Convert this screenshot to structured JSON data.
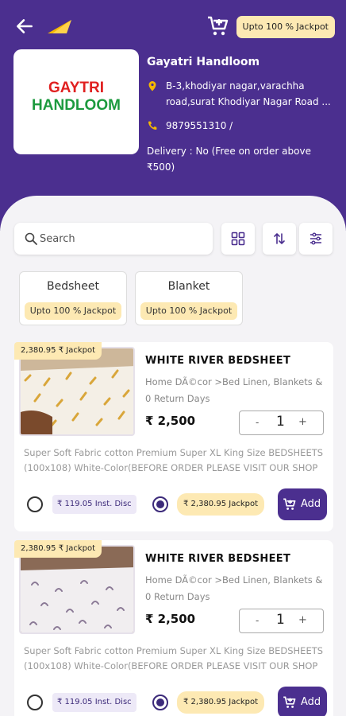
{
  "header": {
    "jackpot_pill": "Upto 100 % Jackpot",
    "store": {
      "logo_line1": "GAYTRI",
      "logo_line2": "HANDLOOM",
      "name": "Gayatri Handloom",
      "address": "B-3,khodiyar nagar,varachha road,surat Khodiyar Nagar Road ...",
      "phone": "9879551310 /",
      "delivery": "Delivery : No (Free on order above ₹500)"
    }
  },
  "search": {
    "placeholder": "Search"
  },
  "categories": [
    {
      "name": "Bedsheet",
      "badge": "Upto 100 % Jackpot"
    },
    {
      "name": "Blanket",
      "badge": "Upto 100 % Jackpot"
    }
  ],
  "products": [
    {
      "badge": "2,380.95 ₹ Jackpot",
      "title": "WHITE RIVER BEDSHEET",
      "category": "Home DÃ©cor >Bed Linen, Blankets & 0 Return Days",
      "price": "₹ 2,500",
      "qty_minus": "-",
      "qty": "1",
      "qty_plus": "+",
      "description": "Super Soft Fabric cotton Premium Super XL King Size  BEDSHEETS (100x108) White-Color(BEFORE ORDER PLEASE VISIT OUR SHOP FOR...",
      "inst_disc": "₹ 119.05 Inst. Disc",
      "jackpot": "₹ 2,380.95 Jackpot",
      "add_label": "Add"
    },
    {
      "badge": "2,380.95 ₹ Jackpot",
      "title": "WHITE RIVER BEDSHEET",
      "category": "Home DÃ©cor >Bed Linen, Blankets & 0 Return Days",
      "price": "₹ 2,500",
      "qty_minus": "-",
      "qty": "1",
      "qty_plus": "+",
      "description": "Super Soft Fabric cotton Premium Super XL King Size  BEDSHEETS (100x108) White-Color(BEFORE ORDER PLEASE VISIT OUR SHOP FOR...",
      "inst_disc": "₹ 119.05 Inst. Disc",
      "jackpot": "₹ 2,380.95 Jackpot",
      "add_label": "Add"
    }
  ],
  "icons": {
    "back": "back-arrow-icon",
    "brand": "brand-logo-icon",
    "cart": "cart-add-icon",
    "location": "location-pin-icon",
    "phone": "phone-icon",
    "search": "search-icon",
    "grid": "grid-view-icon",
    "sort": "sort-icon",
    "filter": "filter-icon"
  },
  "colors": {
    "primary": "#4b2f8f",
    "jackpot_bg": "#fde9b3",
    "accent_icon": "#f5b800",
    "logo_red": "#e02020",
    "logo_green": "#1c9a3e"
  }
}
